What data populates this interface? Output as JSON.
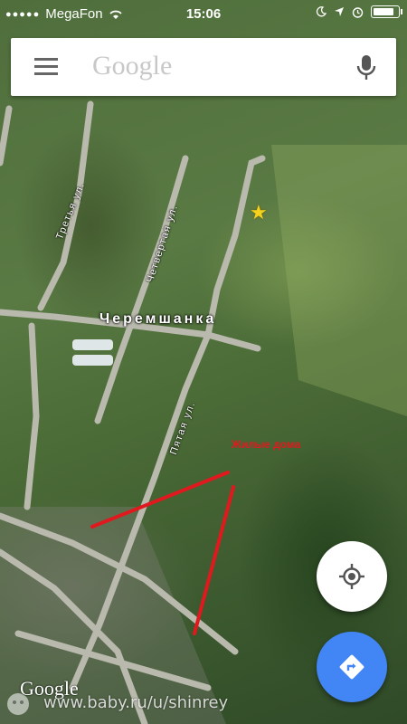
{
  "status_bar": {
    "carrier": "MegaFon",
    "time": "15:06"
  },
  "search": {
    "placeholder": "Google"
  },
  "map": {
    "place_name": "Черемшанка",
    "streets": {
      "third": "Третья ул.",
      "fourth": "Четвертая ул.",
      "fifth": "Пятая ул."
    },
    "annotation": "Жилые дома",
    "marker": "star"
  },
  "branding": {
    "logo": "Google",
    "watermark": "www.baby.ru/u/shinrey"
  },
  "icons": {
    "menu": "menu-icon",
    "mic": "mic-icon",
    "my_location": "my-location-icon",
    "directions": "directions-icon"
  },
  "colors": {
    "directions_fab": "#4285f4",
    "annotation": "#e0191e",
    "marker": "#f5d21e"
  }
}
